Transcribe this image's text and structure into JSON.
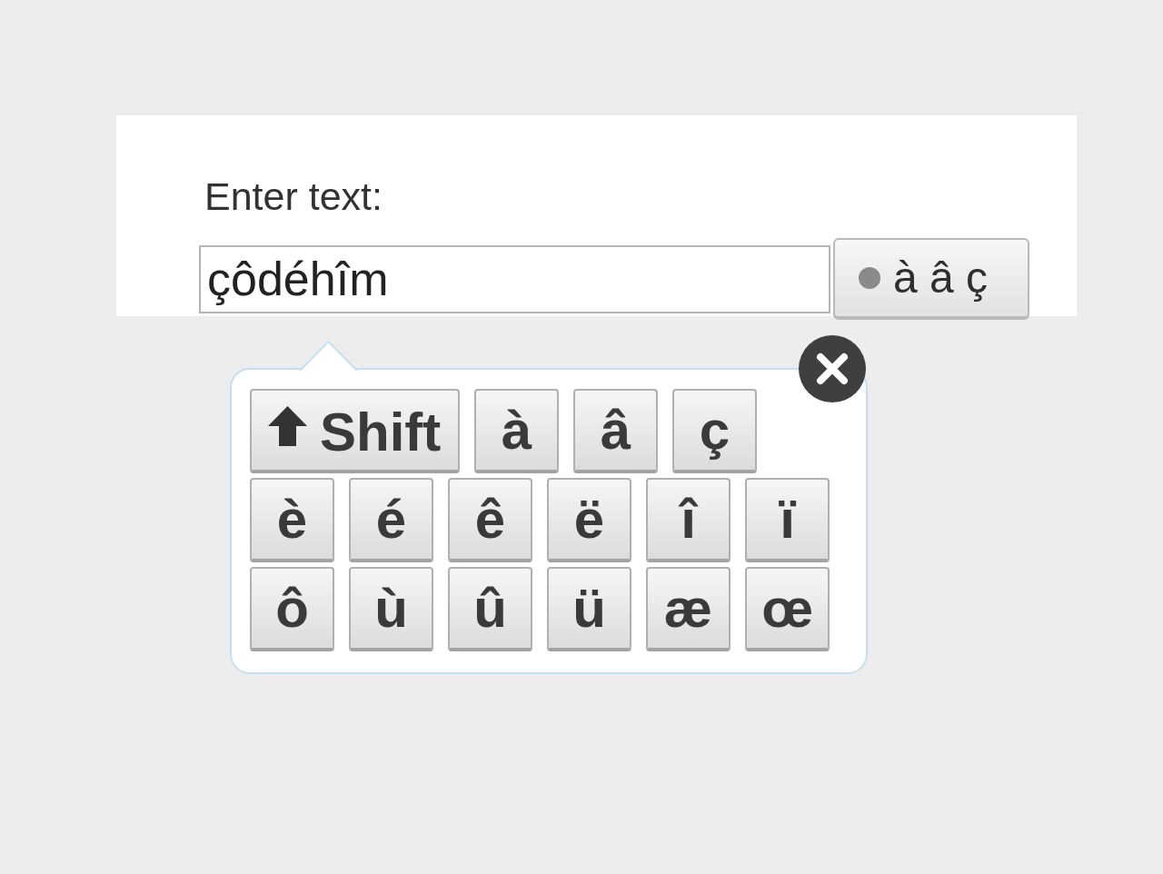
{
  "form": {
    "label": "Enter text:",
    "input": {
      "value": "çôdéhîm"
    },
    "keyboard_button": {
      "label": "à â ç"
    }
  },
  "keyboard": {
    "rows": [
      {
        "keys": [
          {
            "kind": "shift",
            "label": "Shift"
          },
          {
            "kind": "char",
            "label": "à"
          },
          {
            "kind": "char",
            "label": "â"
          },
          {
            "kind": "char",
            "label": "ç"
          }
        ]
      },
      {
        "keys": [
          {
            "kind": "char",
            "label": "è"
          },
          {
            "kind": "char",
            "label": "é"
          },
          {
            "kind": "char",
            "label": "ê"
          },
          {
            "kind": "char",
            "label": "ë"
          },
          {
            "kind": "char",
            "label": "î"
          },
          {
            "kind": "char",
            "label": "ï"
          }
        ]
      },
      {
        "keys": [
          {
            "kind": "char",
            "label": "ô"
          },
          {
            "kind": "char",
            "label": "ù"
          },
          {
            "kind": "char",
            "label": "û"
          },
          {
            "kind": "char",
            "label": "ü"
          },
          {
            "kind": "char",
            "label": "æ"
          },
          {
            "kind": "char",
            "label": "œ"
          }
        ]
      }
    ]
  }
}
